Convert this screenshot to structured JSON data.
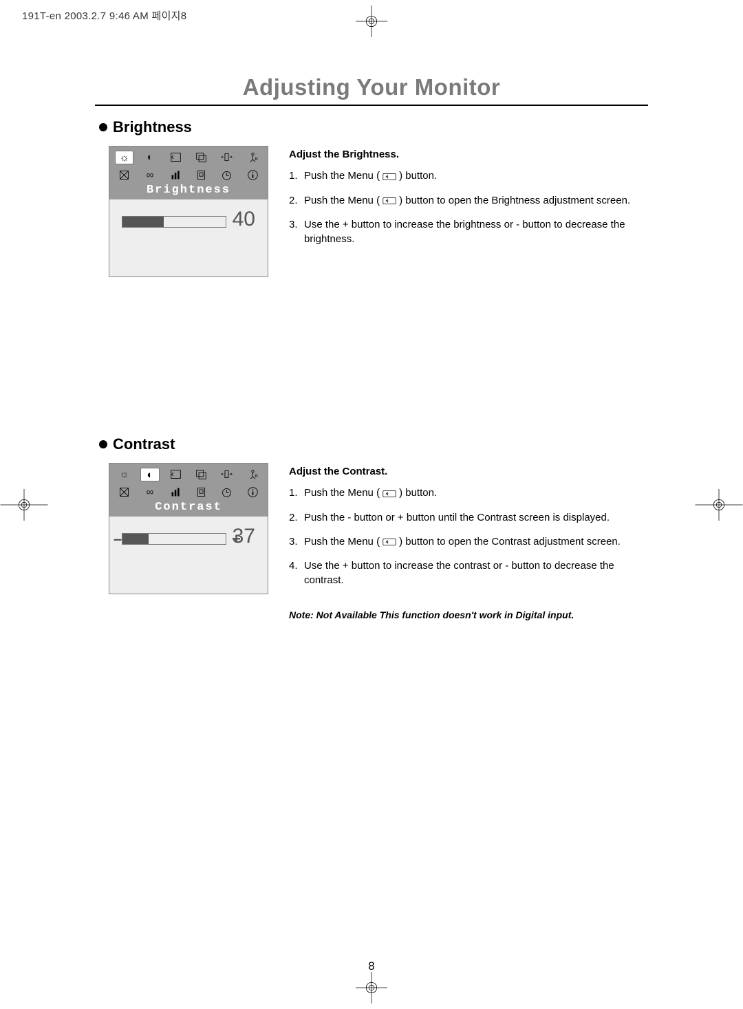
{
  "running_head": "191T-en  2003.2.7 9:46 AM  페이지8",
  "page_title": "Adjusting Your Monitor",
  "page_number": "8",
  "sections": {
    "brightness": {
      "heading": "Brightness",
      "osd_label": "Brightness",
      "osd_value": "40",
      "fill_percent": 40,
      "instr_title": "Adjust the Brightness.",
      "steps": [
        {
          "n": "1",
          "before": "Push the Menu (",
          "after": ") button."
        },
        {
          "n": "2",
          "before": "Push the Menu (",
          "after": ") button to open the Brightness adjustment  screen."
        },
        {
          "n": "3",
          "plain": "Use the + button to increase the brightness or - button to decrease the brightness."
        }
      ]
    },
    "contrast": {
      "heading": "Contrast",
      "osd_label": "Contrast",
      "osd_value": "37",
      "fill_percent": 37,
      "instr_title": "Adjust the Contrast.",
      "steps": [
        {
          "n": "1",
          "before": "Push the Menu (",
          "after": ") button."
        },
        {
          "n": "2",
          "plain": "Push the - button or + button until the Contrast screen is displayed."
        },
        {
          "n": "3",
          "before": "Push the Menu (",
          "after": ") button to open the Contrast adjustment screen."
        },
        {
          "n": "4",
          "plain": "Use the + button to increase the contrast or - button to decrease the contrast."
        }
      ],
      "note": "Note: Not Available This function doesn't work in Digital input."
    }
  },
  "osd_icons_row1": [
    "brightness-icon",
    "contrast-icon",
    "menu-back-icon",
    "window-icon",
    "width-icon",
    "person-icon"
  ],
  "osd_icons_row2": [
    "corners-icon",
    "infinity-icon",
    "vol-icon",
    "page-icon",
    "timer-icon",
    "info-icon"
  ]
}
